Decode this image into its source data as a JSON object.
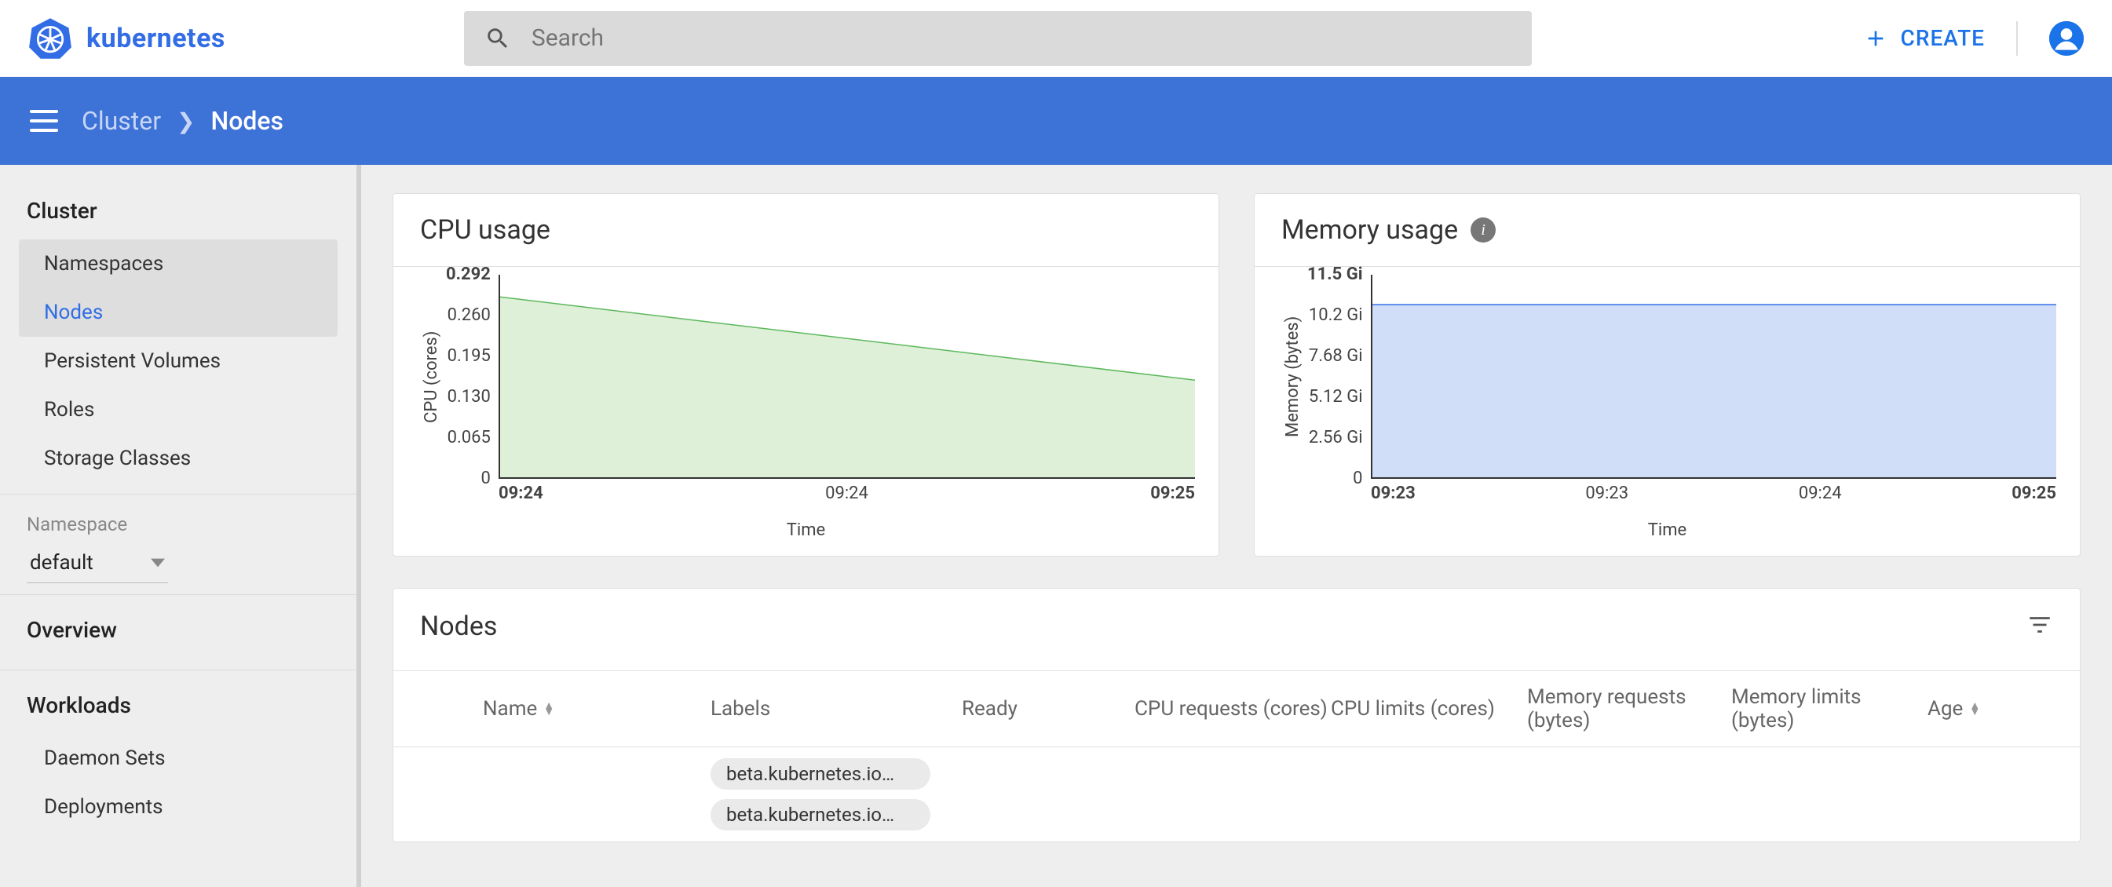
{
  "header": {
    "app_name": "kubernetes",
    "search_placeholder": "Search",
    "create_label": "CREATE"
  },
  "breadcrumb": {
    "parent": "Cluster",
    "current": "Nodes"
  },
  "sidebar": {
    "group_cluster": "Cluster",
    "items_cluster": [
      "Namespaces",
      "Nodes",
      "Persistent Volumes",
      "Roles",
      "Storage Classes"
    ],
    "active_cluster_index": 1,
    "ns_label": "Namespace",
    "ns_selected": "default",
    "group_overview": "Overview",
    "group_workloads": "Workloads",
    "items_workloads": [
      "Daemon Sets",
      "Deployments"
    ]
  },
  "charts": {
    "cpu": {
      "title": "CPU usage",
      "ylabel": "CPU (cores)",
      "xlabel": "Time"
    },
    "mem": {
      "title": "Memory usage",
      "ylabel": "Memory (bytes)",
      "xlabel": "Time"
    }
  },
  "chart_data": [
    {
      "id": "cpu",
      "type": "area",
      "title": "CPU usage",
      "xlabel": "Time",
      "ylabel": "CPU (cores)",
      "ylim": [
        0,
        0.292
      ],
      "yticks": [
        "0.292",
        "0.260",
        "0.195",
        "0.130",
        "0.065",
        "0"
      ],
      "xticks": [
        "09:24",
        "09:24",
        "09:25"
      ],
      "xtick_bold": [
        true,
        false,
        true
      ],
      "series": [
        {
          "name": "cpu",
          "color": "#5cb85c",
          "fill": "#dff0d8",
          "points": [
            {
              "x": 0,
              "y": 0.26
            },
            {
              "x": 1,
              "y": 0.14
            }
          ]
        }
      ]
    },
    {
      "id": "mem",
      "type": "area",
      "title": "Memory usage",
      "xlabel": "Time",
      "ylabel": "Memory (bytes)",
      "ylim": [
        0,
        11.5
      ],
      "yticks": [
        "11.5 Gi",
        "10.2 Gi",
        "7.68 Gi",
        "5.12 Gi",
        "2.56 Gi",
        "0"
      ],
      "xticks": [
        "09:23",
        "09:23",
        "09:24",
        "09:25"
      ],
      "xtick_bold": [
        true,
        false,
        false,
        true
      ],
      "series": [
        {
          "name": "mem",
          "color": "#326de6",
          "fill": "#d0dff7",
          "points": [
            {
              "x": 0,
              "y": 9.8
            },
            {
              "x": 1,
              "y": 9.8
            }
          ]
        }
      ]
    }
  ],
  "nodes_table": {
    "title": "Nodes",
    "columns": {
      "name": "Name",
      "labels": "Labels",
      "ready": "Ready",
      "cpu_req": "CPU requests (cores)",
      "cpu_lim": "CPU limits (cores)",
      "mem_req": "Memory requests (bytes)",
      "mem_lim": "Memory limits (bytes)",
      "age": "Age"
    },
    "rows": [
      {
        "labels": [
          "beta.kubernetes.io…",
          "beta.kubernetes.io…"
        ]
      }
    ]
  }
}
